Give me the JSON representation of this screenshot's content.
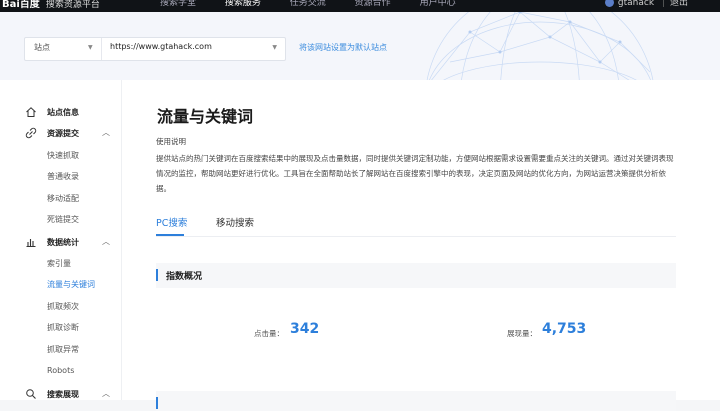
{
  "topbar": {
    "logo": "Bai百度",
    "subtitle": "搜索资源平台",
    "nav": [
      "搜索学堂",
      "搜索服务",
      "任务交流",
      "资源合作",
      "用户中心"
    ],
    "active_nav": "搜索服务",
    "username": "gtahack",
    "logout": "退出"
  },
  "site_selector": {
    "label": "站点",
    "url": "https://www.gtahack.com",
    "set_default": "将该网站设置为默认站点"
  },
  "sidebar": {
    "site_info": "站点信息",
    "resource_submit": "资源提交",
    "resource_items": [
      "快速抓取",
      "普通收录",
      "移动适配",
      "死链提交"
    ],
    "data_stats": "数据统计",
    "data_items": [
      "索引量",
      "流量与关键词",
      "抓取频次",
      "抓取诊断",
      "抓取异常",
      "Robots"
    ],
    "active_item": "流量与关键词",
    "search_display": "搜索展现"
  },
  "main": {
    "title": "流量与关键词",
    "usage_label": "使用说明",
    "usage_text": "提供站点的热门关键词在百度搜索结果中的展现及点击量数据，同时提供关键词定制功能，方便网站根据需求设置需要重点关注的关键词。通过对关键词表现情况的监控，帮助网站更好进行优化。工具旨在全面帮助站长了解网站在百度搜索引擎中的表现，决定页面及网站的优化方向，为网站运营决策提供分析依据。",
    "tabs": [
      "PC搜索",
      "移动搜索"
    ],
    "active_tab": "PC搜索",
    "overview_title": "指数概况",
    "clicks_label": "点击量：",
    "clicks_value": "342",
    "impressions_label": "展现量：",
    "impressions_value": "4,753"
  },
  "colors": {
    "accent": "#2d7fdb",
    "topbar_bg": "#101317"
  }
}
